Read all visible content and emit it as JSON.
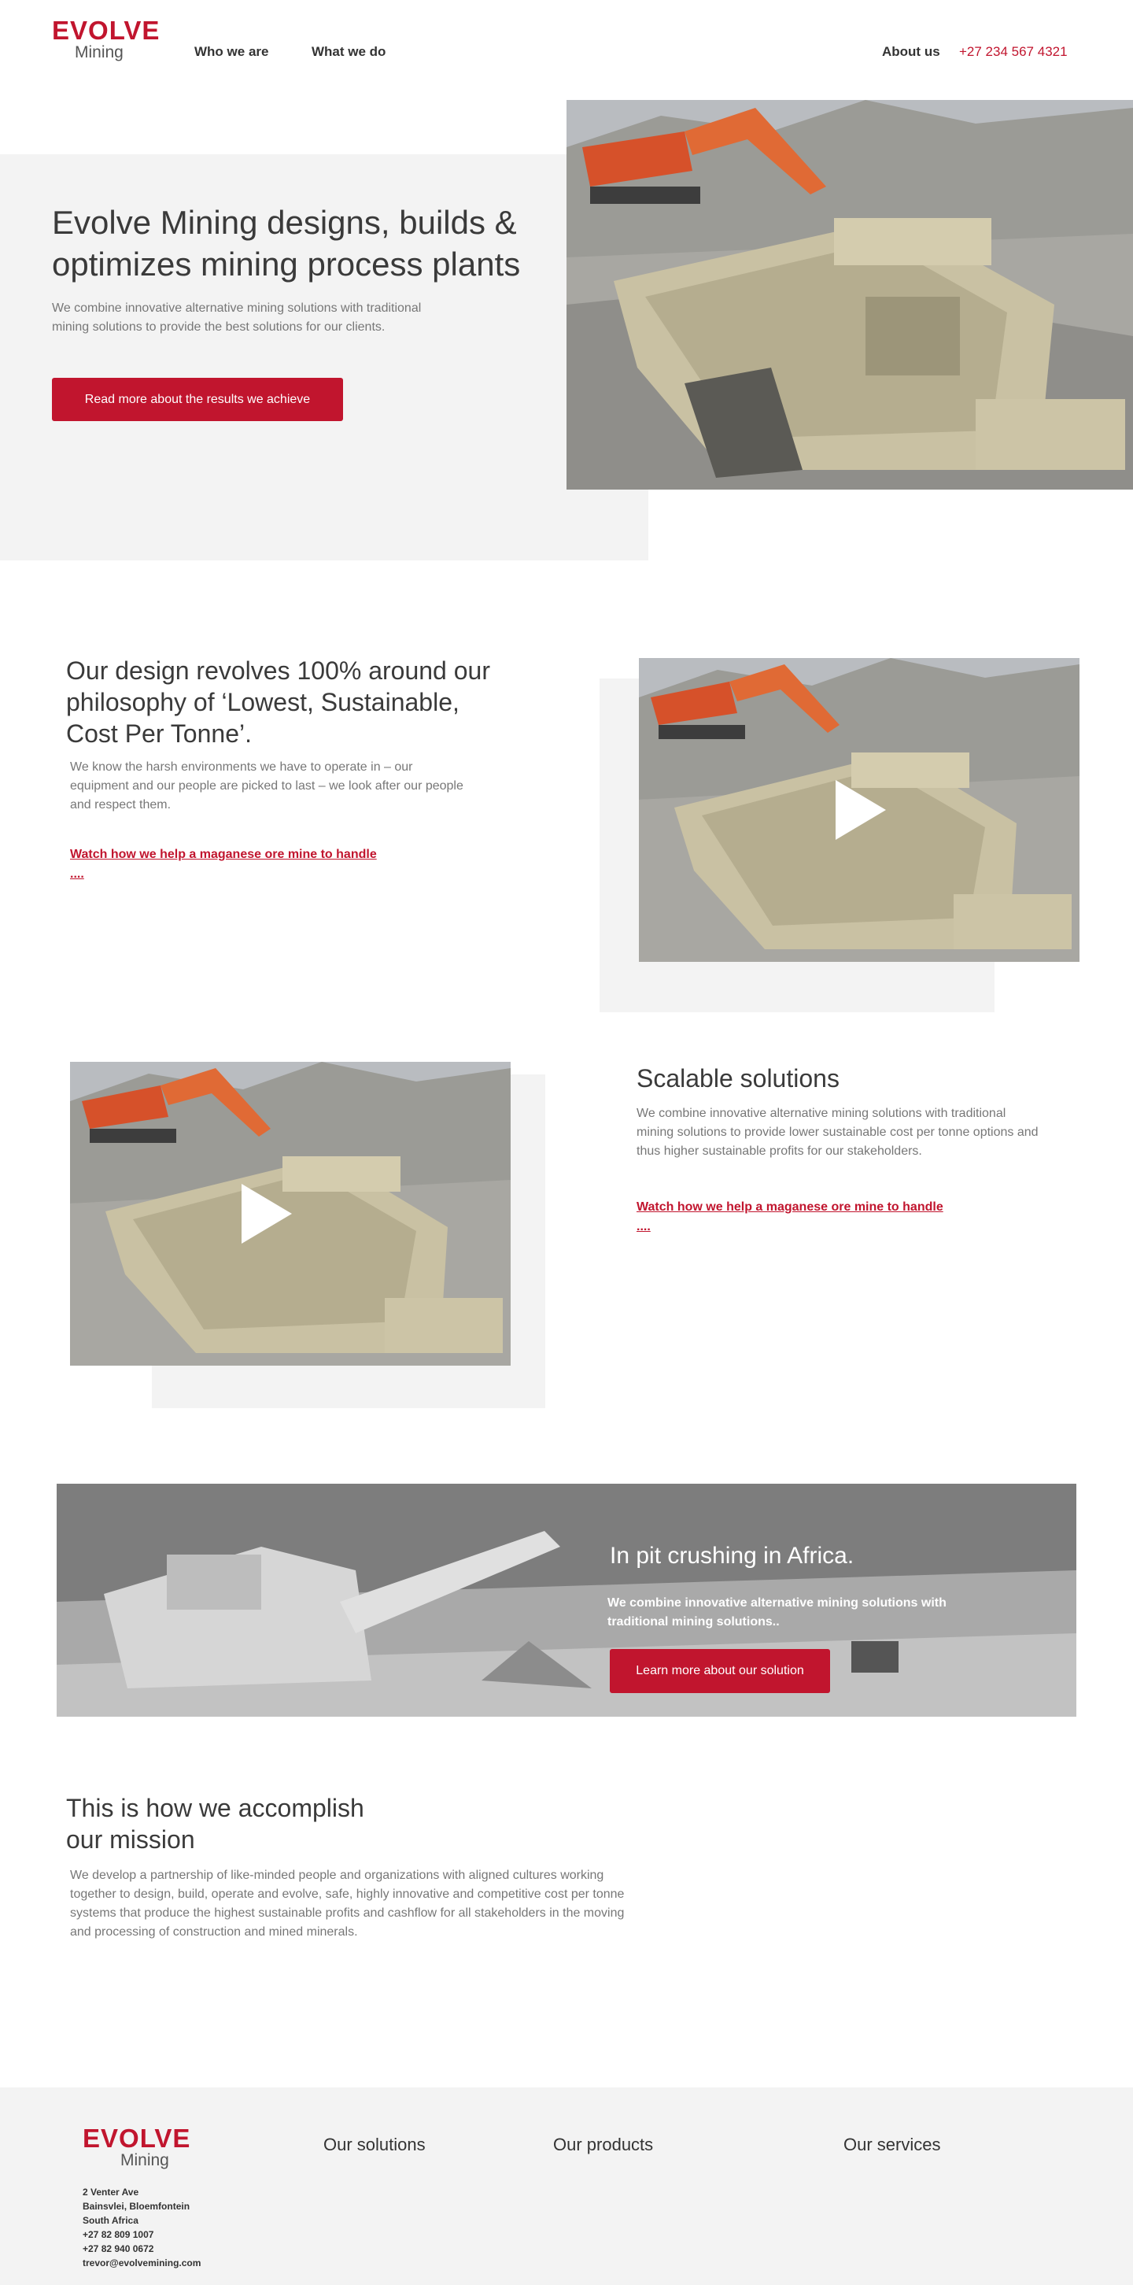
{
  "colors": {
    "brand_red": "#c1152e",
    "panel_gray": "#f3f3f3",
    "heading": "#3a3a3a",
    "body_text": "#777777"
  },
  "header": {
    "logo": {
      "word": "EVOLVE",
      "sub": "Mining"
    },
    "nav": [
      {
        "label": "Who we are"
      },
      {
        "label": "What we do"
      },
      {
        "label": "About us"
      }
    ],
    "phone": "+27 234 567 4321"
  },
  "hero": {
    "title": "Evolve Mining designs, builds & optimizes mining process plants",
    "text": "We combine innovative alternative mining solutions with traditional mining solutions to provide the best solutions for our clients.",
    "button": "Read more about the results we achieve",
    "image_icon": "mining-crusher-photo"
  },
  "philosophy": {
    "title": "Our design revolves 100% around our philosophy of ‘Lowest, Sustainable, Cost Per Tonne’.",
    "text": "We know the harsh environments we have to operate in – our equipment and our people are picked to last – we look after our people and respect them.",
    "link": "Watch how we help a maganese ore mine to handle ....",
    "video_icon": "play-icon"
  },
  "scalable": {
    "title": "Scalable solutions",
    "text": "We combine innovative alternative mining solutions with traditional mining solutions to provide lower sustainable cost per tonne options and thus higher sustainable profits for our stakeholders.",
    "link": "Watch how we help a maganese ore mine to handle ....",
    "video_icon": "play-icon"
  },
  "banner": {
    "title": "In pit crushing in Africa.",
    "text": "We combine innovative alternative mining solutions with traditional mining solutions..",
    "button": "Learn more about our solution"
  },
  "mission": {
    "title": "This is how we accomplish our mission",
    "text": "We develop a partnership of like-minded people and organizations with aligned cultures working together to design, build, operate and evolve, safe, highly innovative and competitive cost per tonne systems that produce the highest sustainable profits and cashflow for all stakeholders in the moving and processing of construction and mined minerals."
  },
  "footer": {
    "logo": {
      "word": "EVOLVE",
      "sub": "Mining"
    },
    "headings": [
      "Our solutions",
      "Our products",
      "Our services"
    ],
    "address": [
      "2 Venter Ave",
      "Bainsvlei, Bloemfontein",
      "South Africa",
      "+27 82 809 1007",
      "+27 82 940 0672",
      "trevor@evolvemining.com"
    ]
  }
}
